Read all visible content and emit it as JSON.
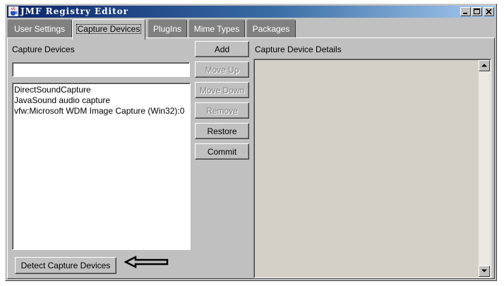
{
  "window": {
    "title": "JMF Registry Editor",
    "controls": {
      "minimize_icon": "minimize-icon",
      "maximize_icon": "maximize-icon",
      "close_icon": "close-icon"
    }
  },
  "tabs": [
    {
      "label": "User Settings",
      "active": false
    },
    {
      "label": "Capture Devices",
      "active": true
    },
    {
      "label": "PlugIns",
      "active": false
    },
    {
      "label": "Mime Types",
      "active": false
    },
    {
      "label": "Packages",
      "active": false
    }
  ],
  "capture_panel": {
    "list_title": "Capture Devices",
    "input_value": "",
    "devices": [
      "DirectSoundCapture",
      "JavaSound audio capture",
      "vfw:Microsoft WDM Image Capture (Win32):0"
    ],
    "detect_button": "Detect Capture Devices"
  },
  "actions": {
    "add": {
      "label": "Add",
      "enabled": true
    },
    "move_up": {
      "label": "Move Up",
      "enabled": false
    },
    "move_down": {
      "label": "Move Down",
      "enabled": false
    },
    "remove": {
      "label": "Remove",
      "enabled": false
    },
    "restore": {
      "label": "Restore",
      "enabled": true
    },
    "commit": {
      "label": "Commit",
      "enabled": true
    }
  },
  "details_panel": {
    "title": "Capture Device  Details"
  },
  "colors": {
    "face": "#c0c0c0",
    "titlebar_start": "#0a246a",
    "titlebar_end": "#a6caf0",
    "tab_inactive": "#808080"
  }
}
